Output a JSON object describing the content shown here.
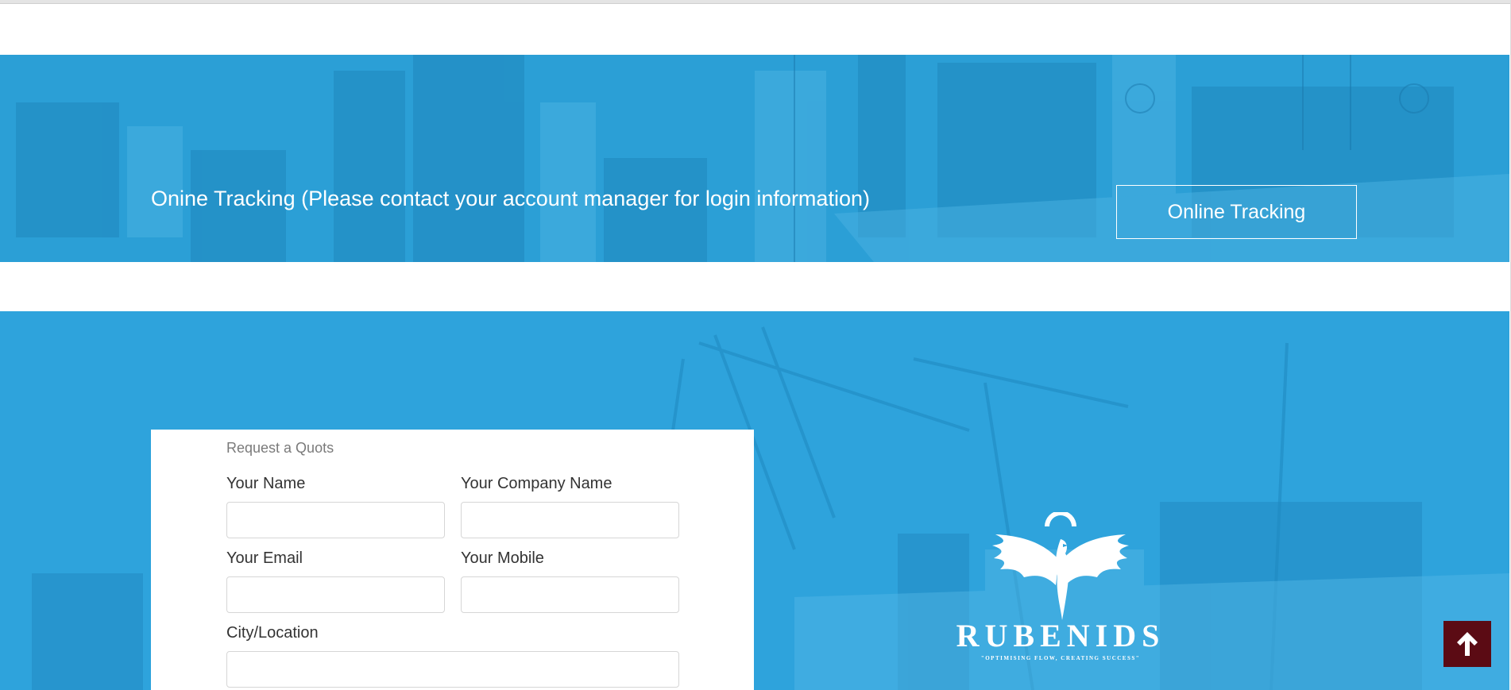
{
  "tracking": {
    "message": "Onine Tracking (Please contact your account manager for login information)",
    "button_label": "Online Tracking"
  },
  "quote_form": {
    "title": "Request a Quots",
    "fields": {
      "name": {
        "label": "Your Name",
        "value": ""
      },
      "company": {
        "label": "Your Company Name",
        "value": ""
      },
      "email": {
        "label": "Your Email",
        "value": ""
      },
      "mobile": {
        "label": "Your Mobile",
        "value": ""
      },
      "city": {
        "label": "City/Location",
        "value": ""
      }
    }
  },
  "brand": {
    "name": "RUBENIDS",
    "tagline": "\"OPTIMISING FLOW, CREATING SUCCESS\""
  },
  "icons": {
    "back_to_top": "arrow-up-icon",
    "logo": "phoenix-logo-icon"
  },
  "colors": {
    "banner_blue": "#2b9fd6",
    "back_to_top_bg": "#5b0b14"
  }
}
